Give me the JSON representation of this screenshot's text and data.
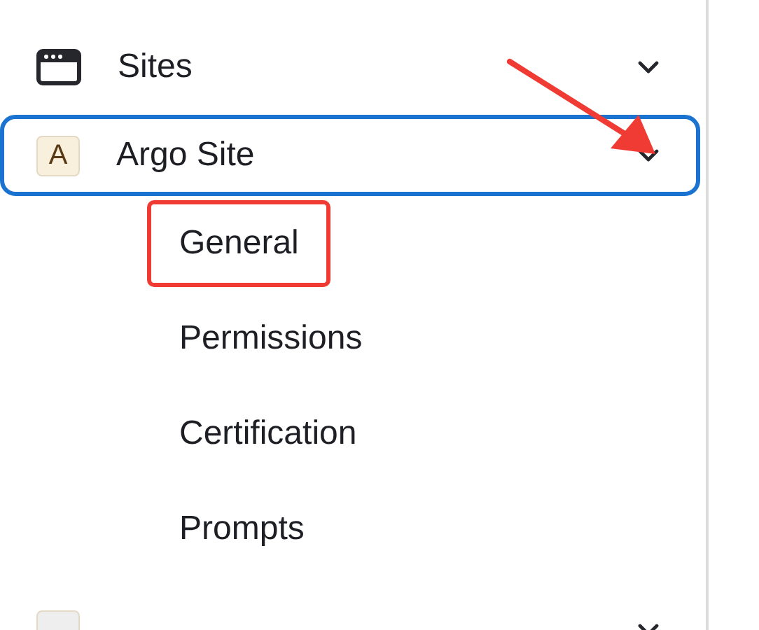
{
  "nav_items": [
    {
      "kind": "icon",
      "label": "Sites",
      "focused": false
    },
    {
      "kind": "badge",
      "badge": "A",
      "color": "#f8efdc",
      "label": "Argo Site",
      "focused": true,
      "children": [
        {
          "label": "General",
          "highlighted": true
        },
        {
          "label": "Permissions",
          "highlighted": false
        },
        {
          "label": "Certification",
          "highlighted": false
        },
        {
          "label": "Prompts",
          "highlighted": false
        }
      ]
    },
    {
      "kind": "badge",
      "color": "#eeeeee",
      "focused": false
    }
  ]
}
